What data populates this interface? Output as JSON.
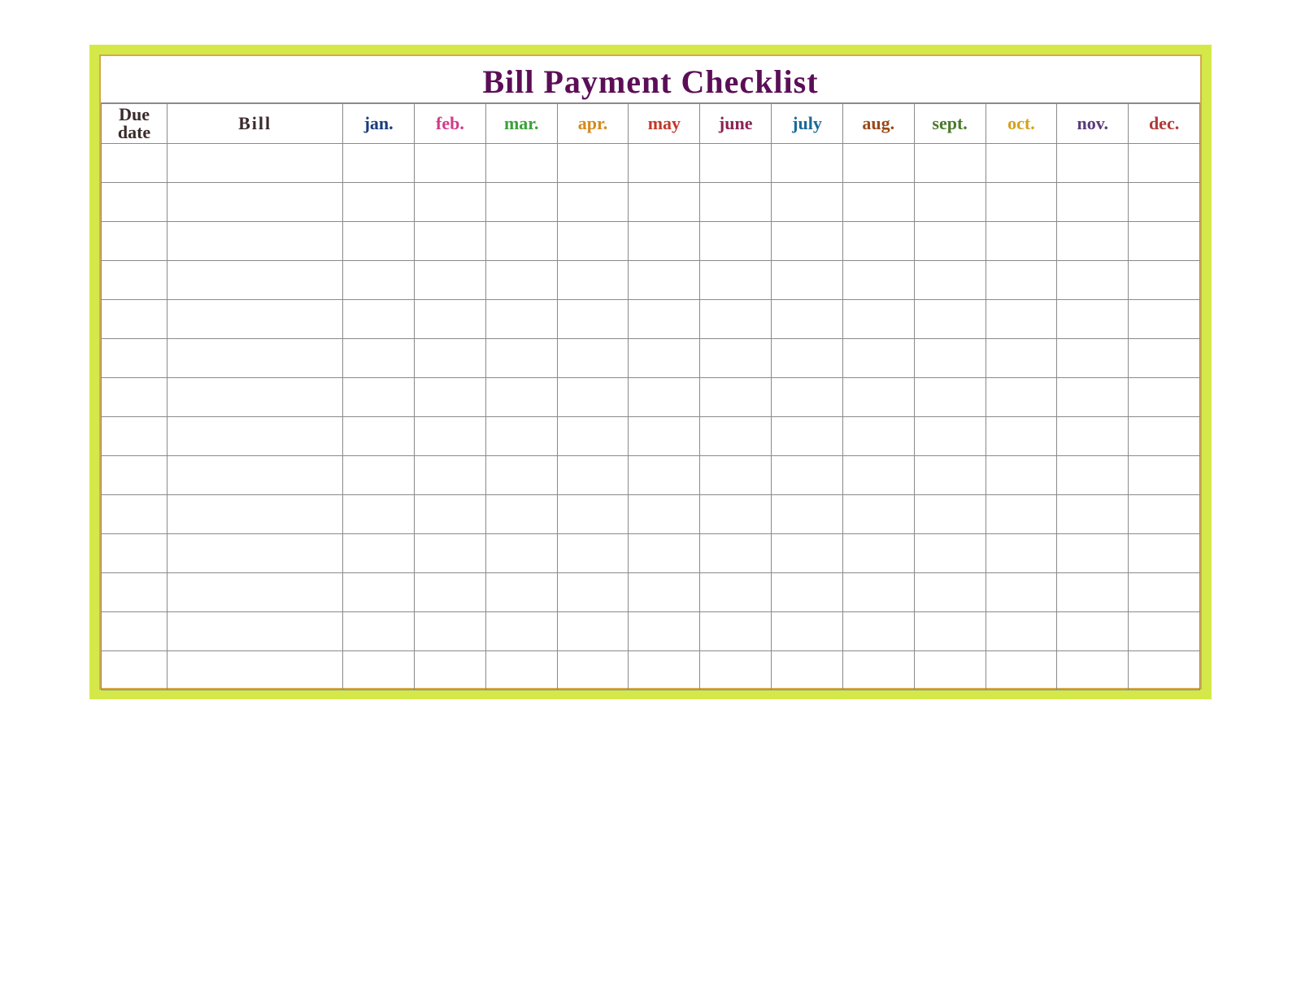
{
  "title": "Bill Payment Checklist",
  "headers": {
    "due_date": "Due date",
    "bill": "Bill",
    "months": [
      "jan.",
      "feb.",
      "mar.",
      "apr.",
      "may",
      "june",
      "july",
      "aug.",
      "sept.",
      "oct.",
      "nov.",
      "dec."
    ]
  },
  "month_colors": [
    "#1a3d7c",
    "#d23a8a",
    "#3aa23a",
    "#d48a1a",
    "#c0392b",
    "#8a2253",
    "#1a6a9a",
    "#9a4a1a",
    "#4a7a2a",
    "#d4a11a",
    "#5a3a7a",
    "#b03a3a"
  ],
  "rows": [
    {
      "due_date": "",
      "bill": "",
      "months": [
        "",
        "",
        "",
        "",
        "",
        "",
        "",
        "",
        "",
        "",
        "",
        ""
      ]
    },
    {
      "due_date": "",
      "bill": "",
      "months": [
        "",
        "",
        "",
        "",
        "",
        "",
        "",
        "",
        "",
        "",
        "",
        ""
      ]
    },
    {
      "due_date": "",
      "bill": "",
      "months": [
        "",
        "",
        "",
        "",
        "",
        "",
        "",
        "",
        "",
        "",
        "",
        ""
      ]
    },
    {
      "due_date": "",
      "bill": "",
      "months": [
        "",
        "",
        "",
        "",
        "",
        "",
        "",
        "",
        "",
        "",
        "",
        ""
      ]
    },
    {
      "due_date": "",
      "bill": "",
      "months": [
        "",
        "",
        "",
        "",
        "",
        "",
        "",
        "",
        "",
        "",
        "",
        ""
      ]
    },
    {
      "due_date": "",
      "bill": "",
      "months": [
        "",
        "",
        "",
        "",
        "",
        "",
        "",
        "",
        "",
        "",
        "",
        ""
      ]
    },
    {
      "due_date": "",
      "bill": "",
      "months": [
        "",
        "",
        "",
        "",
        "",
        "",
        "",
        "",
        "",
        "",
        "",
        ""
      ]
    },
    {
      "due_date": "",
      "bill": "",
      "months": [
        "",
        "",
        "",
        "",
        "",
        "",
        "",
        "",
        "",
        "",
        "",
        ""
      ]
    },
    {
      "due_date": "",
      "bill": "",
      "months": [
        "",
        "",
        "",
        "",
        "",
        "",
        "",
        "",
        "",
        "",
        "",
        ""
      ]
    },
    {
      "due_date": "",
      "bill": "",
      "months": [
        "",
        "",
        "",
        "",
        "",
        "",
        "",
        "",
        "",
        "",
        "",
        ""
      ]
    },
    {
      "due_date": "",
      "bill": "",
      "months": [
        "",
        "",
        "",
        "",
        "",
        "",
        "",
        "",
        "",
        "",
        "",
        ""
      ]
    },
    {
      "due_date": "",
      "bill": "",
      "months": [
        "",
        "",
        "",
        "",
        "",
        "",
        "",
        "",
        "",
        "",
        "",
        ""
      ]
    },
    {
      "due_date": "",
      "bill": "",
      "months": [
        "",
        "",
        "",
        "",
        "",
        "",
        "",
        "",
        "",
        "",
        "",
        ""
      ]
    },
    {
      "due_date": "",
      "bill": "",
      "months": [
        "",
        "",
        "",
        "",
        "",
        "",
        "",
        "",
        "",
        "",
        "",
        ""
      ]
    }
  ]
}
